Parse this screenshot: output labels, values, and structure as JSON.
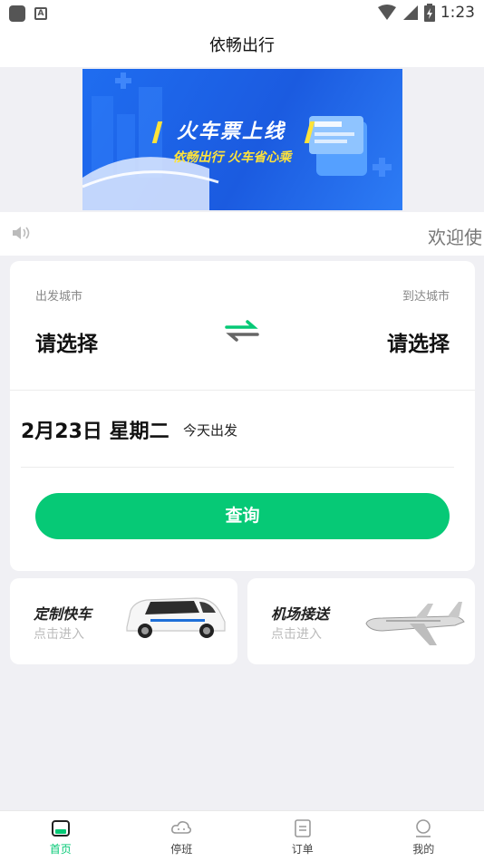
{
  "status_bar": {
    "time": "1:23"
  },
  "app": {
    "title": "依畅出行"
  },
  "banner": {
    "title": "火车票上线",
    "subtitle": "依畅出行  火车省心乘"
  },
  "notice": {
    "text": "欢迎使"
  },
  "booking": {
    "from_label": "出发城市",
    "to_label": "到达城市",
    "from_value": "请选择",
    "to_value": "请选择",
    "date": "2月23日 星期二",
    "date_hint": "今天出发",
    "search_label": "查询"
  },
  "services": [
    {
      "title": "定制快车",
      "subtitle": "点击进入"
    },
    {
      "title": "机场接送",
      "subtitle": "点击进入"
    }
  ],
  "tabs": [
    {
      "label": "首页",
      "icon": "home-icon",
      "active": true
    },
    {
      "label": "停班",
      "icon": "cloud-icon",
      "active": false
    },
    {
      "label": "订单",
      "icon": "order-icon",
      "active": false
    },
    {
      "label": "我的",
      "icon": "profile-icon",
      "active": false
    }
  ],
  "colors": {
    "accent": "#06c976",
    "banner_blue": "#1f6df0",
    "banner_yellow": "#ffe33a"
  }
}
